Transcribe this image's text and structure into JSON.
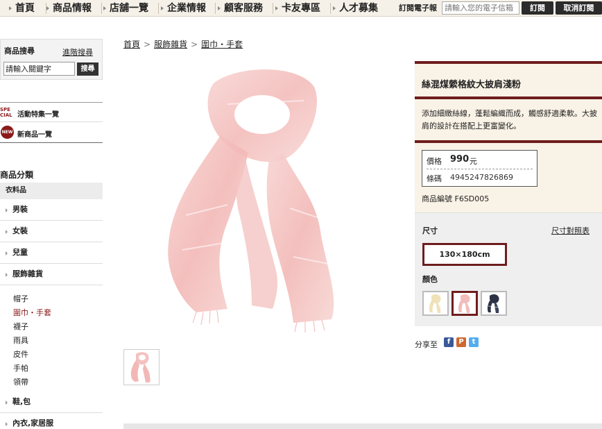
{
  "nav": {
    "items": [
      "首頁",
      "商品情報",
      "店舖一覽",
      "企業情報",
      "顧客服務",
      "卡友專區",
      "人才募集"
    ],
    "subscribe_label": "訂閱電子報",
    "email_placeholder": "請輸入您的電子信箱",
    "subscribe_button": "訂閱",
    "unsubscribe_button": "取消訂閱"
  },
  "sidebar": {
    "search_title": "商品搜尋",
    "advanced_search": "進階搜尋",
    "search_value": "請輸入關鍵字",
    "search_button": "搜尋",
    "special_logo": "SPECIAL",
    "special_label": "活動特集一覽",
    "new_logo": "NEW",
    "new_label": "新商品一覽",
    "category_title": "商品分類",
    "category_group": "衣料品",
    "categories": [
      "男裝",
      "女裝",
      "兒童",
      "服飾雜貨"
    ],
    "subcategories": [
      "帽子",
      "圍巾・手套",
      "襪子",
      "雨具",
      "皮件",
      "手帕",
      "領帶"
    ],
    "active_subcategory": "圍巾・手套",
    "more_categories": [
      "鞋,包",
      "內衣,家居服"
    ]
  },
  "breadcrumb": [
    "首頁",
    "服飾雜貨",
    "圍巾・手套"
  ],
  "product": {
    "title": "絲混煤縈格紋大披肩淺粉",
    "description": "添加細緻絲線，蓬鬆編織而成，觸感舒適柔軟。大披肩的設計在搭配上更富變化。",
    "price_label": "價格",
    "price_value": "990",
    "price_unit": "元",
    "barcode_label": "條碼",
    "barcode_value": "4945247826869",
    "code_label": "商品編號",
    "code_value": "F6SD005",
    "size_label": "尺寸",
    "size_chart_link": "尺寸對照表",
    "size_option": "130×180cm",
    "color_label": "顏色",
    "color_swatches": [
      {
        "name": "cream",
        "color": "#f1e4c0"
      },
      {
        "name": "light-pink",
        "color": "#f2c1c1"
      },
      {
        "name": "navy-plaid",
        "color": "#2d3346"
      }
    ],
    "selected_color": "light-pink",
    "share_label": "分享至",
    "share_icons": [
      "facebook-icon",
      "plurk-icon",
      "twitter-icon"
    ]
  },
  "colors": {
    "accent": "#6e1d1d",
    "nav_bg": "#f5f1e8",
    "panel_bg": "#f9f2e6",
    "scarf_pink": "#f3bcbc"
  }
}
